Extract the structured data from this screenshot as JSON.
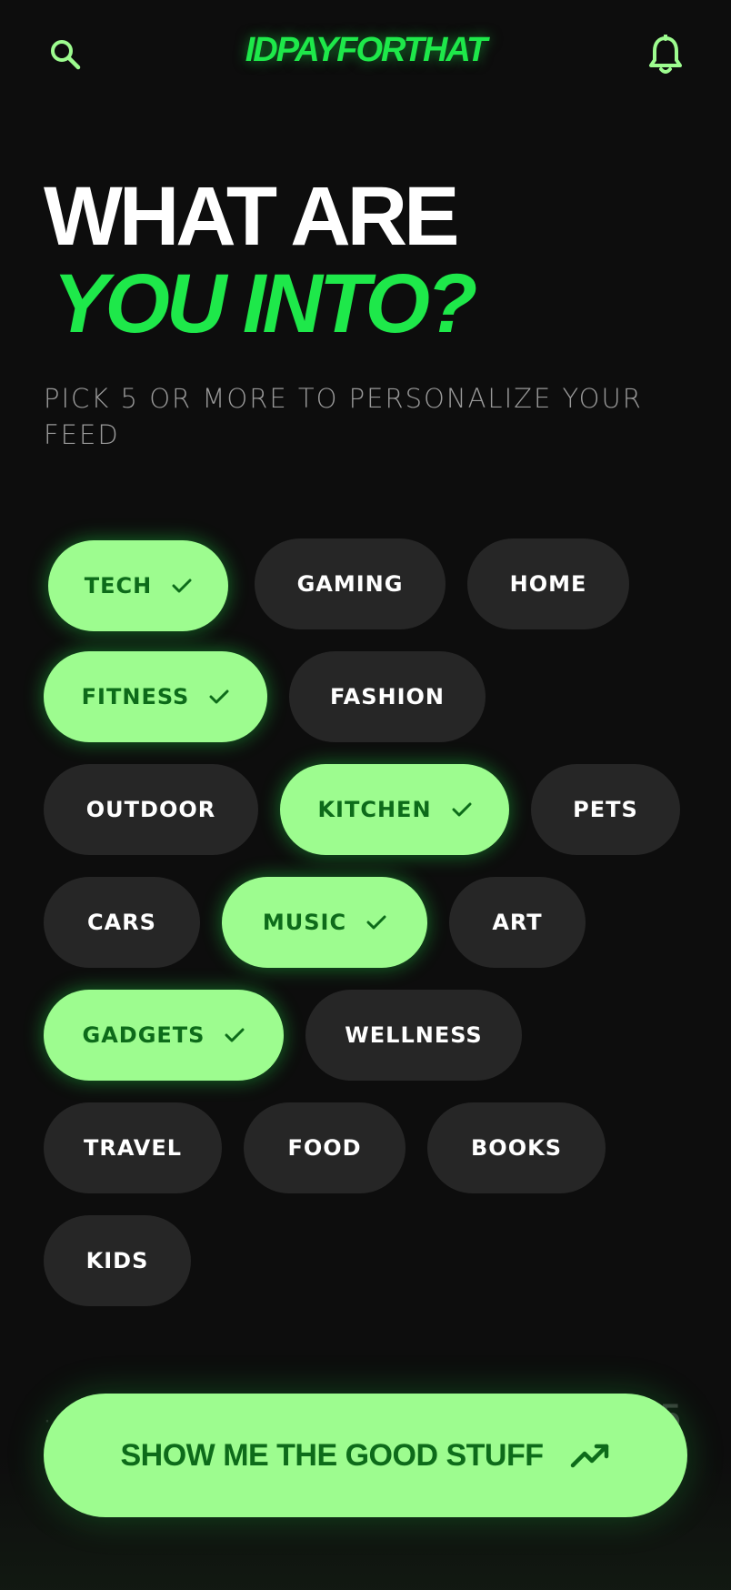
{
  "header": {
    "logo": "IDPAYFORTHAT",
    "search_icon": "search-icon",
    "bell_icon": "bell-icon"
  },
  "hero": {
    "title_line1": "WHAT ARE",
    "title_line2": "YOU INTO?",
    "subtitle": "PICK 5 OR MORE TO PERSONALIZE YOUR FEED"
  },
  "categories": [
    {
      "label": "TECH",
      "selected": true
    },
    {
      "label": "GAMING",
      "selected": false
    },
    {
      "label": "HOME",
      "selected": false
    },
    {
      "label": "FITNESS",
      "selected": true
    },
    {
      "label": "FASHION",
      "selected": false
    },
    {
      "label": "OUTDOOR",
      "selected": false
    },
    {
      "label": "KITCHEN",
      "selected": true
    },
    {
      "label": "PETS",
      "selected": false
    },
    {
      "label": "CARS",
      "selected": false
    },
    {
      "label": "MUSIC",
      "selected": true
    },
    {
      "label": "ART",
      "selected": false
    },
    {
      "label": "GADGETS",
      "selected": true
    },
    {
      "label": "WELLNESS",
      "selected": false
    },
    {
      "label": "TRAVEL",
      "selected": false
    },
    {
      "label": "FOOD",
      "selected": false
    },
    {
      "label": "BOOKS",
      "selected": false
    },
    {
      "label": "KIDS",
      "selected": false
    }
  ],
  "footer": {
    "cta_label": "SHOW ME THE GOOD STUFF",
    "cta_icon": "trending-up-icon",
    "counter_partial": "5"
  },
  "colors": {
    "background": "#0d0d0d",
    "accent": "#1ee84a",
    "chip_selected_bg": "#9dfc8f",
    "chip_selected_text": "#0d6b1a",
    "chip_bg": "#262626"
  }
}
